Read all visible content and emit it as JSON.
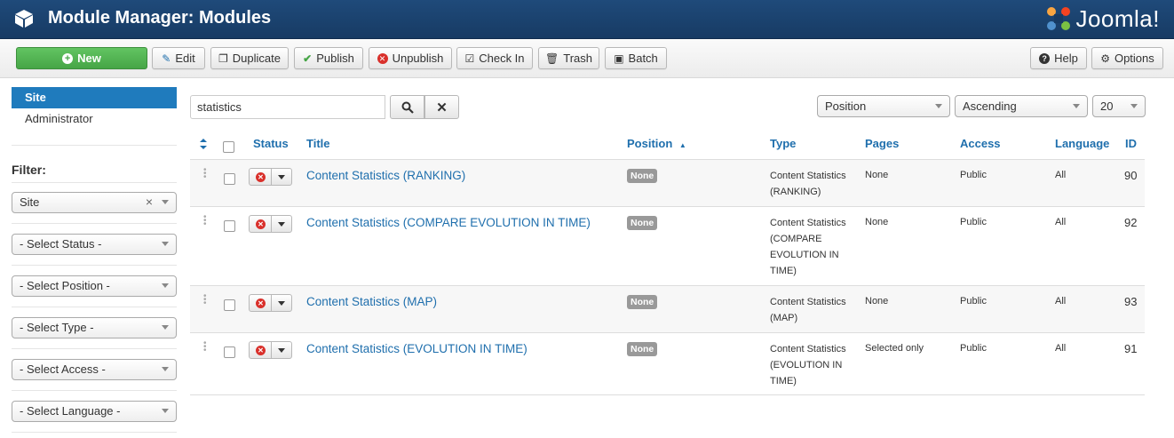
{
  "header": {
    "title": "Module Manager: Modules",
    "brand": "Joomla!"
  },
  "toolbar": {
    "new": "New",
    "edit": "Edit",
    "duplicate": "Duplicate",
    "publish": "Publish",
    "unpublish": "Unpublish",
    "checkin": "Check In",
    "trash": "Trash",
    "batch": "Batch",
    "help": "Help",
    "options": "Options"
  },
  "sidebar": {
    "items": [
      "Site",
      "Administrator"
    ],
    "filter_label": "Filter:",
    "filters": [
      "Site",
      "- Select Status -",
      "- Select Position -",
      "- Select Type -",
      "- Select Access -",
      "- Select Language -"
    ]
  },
  "search": {
    "value": "statistics"
  },
  "sorting": {
    "field": "Position",
    "direction": "Ascending",
    "limit": "20"
  },
  "columns": {
    "status": "Status",
    "title": "Title",
    "position": "Position",
    "type": "Type",
    "pages": "Pages",
    "access": "Access",
    "language": "Language",
    "id": "ID"
  },
  "rows": [
    {
      "title": "Content Statistics (RANKING)",
      "position": "None",
      "type": [
        "Content Statistics",
        "(RANKING)"
      ],
      "pages": "None",
      "access": "Public",
      "language": "All",
      "id": "90"
    },
    {
      "title": "Content Statistics (COMPARE EVOLUTION IN TIME)",
      "position": "None",
      "type": [
        "Content Statistics",
        "(COMPARE",
        "EVOLUTION IN",
        "TIME)"
      ],
      "pages": "None",
      "access": "Public",
      "language": "All",
      "id": "92"
    },
    {
      "title": "Content Statistics (MAP)",
      "position": "None",
      "type": [
        "Content Statistics",
        "(MAP)"
      ],
      "pages": "None",
      "access": "Public",
      "language": "All",
      "id": "93"
    },
    {
      "title": "Content Statistics (EVOLUTION IN TIME)",
      "position": "None",
      "type": [
        "Content Statistics",
        "(EVOLUTION IN",
        "TIME)"
      ],
      "pages": "Selected only",
      "access": "Public",
      "language": "All",
      "id": "91"
    }
  ]
}
